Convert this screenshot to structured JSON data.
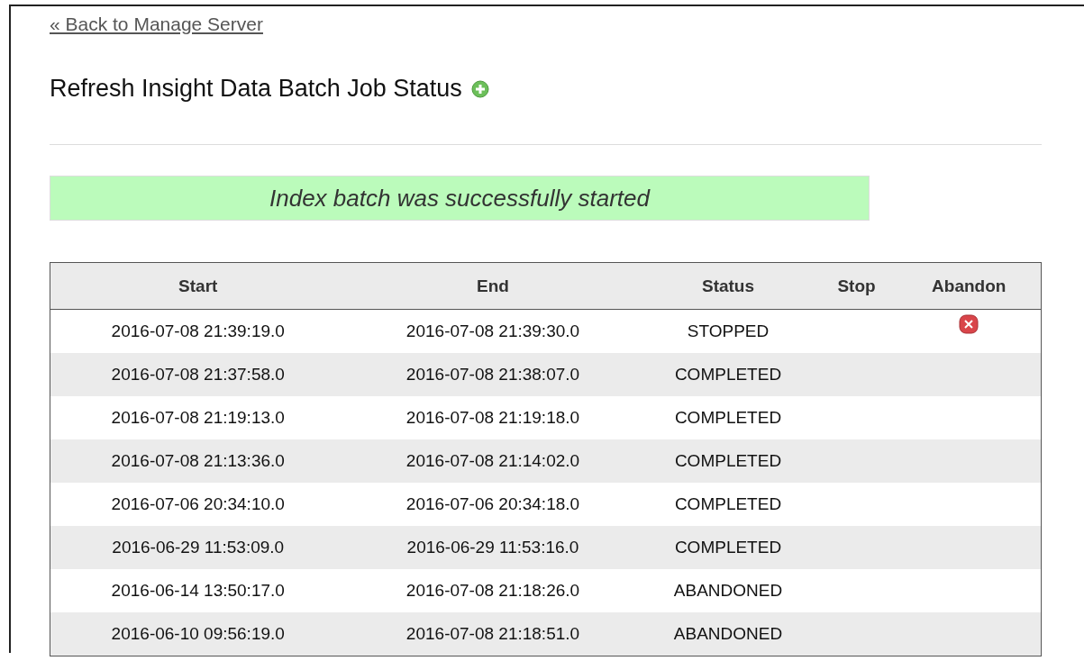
{
  "back_link": "« Back to Manage Server",
  "title": "Refresh Insight Data Batch Job Status",
  "message": "Index batch was successfully started",
  "table": {
    "columns": [
      "Start",
      "End",
      "Status",
      "Stop",
      "Abandon"
    ],
    "rows": [
      {
        "start": "2016-07-08 21:39:19.0",
        "end": "2016-07-08 21:39:30.0",
        "status": "STOPPED",
        "abandon": true
      },
      {
        "start": "2016-07-08 21:37:58.0",
        "end": "2016-07-08 21:38:07.0",
        "status": "COMPLETED",
        "abandon": false
      },
      {
        "start": "2016-07-08 21:19:13.0",
        "end": "2016-07-08 21:19:18.0",
        "status": "COMPLETED",
        "abandon": false
      },
      {
        "start": "2016-07-08 21:13:36.0",
        "end": "2016-07-08 21:14:02.0",
        "status": "COMPLETED",
        "abandon": false
      },
      {
        "start": "2016-07-06 20:34:10.0",
        "end": "2016-07-06 20:34:18.0",
        "status": "COMPLETED",
        "abandon": false
      },
      {
        "start": "2016-06-29 11:53:09.0",
        "end": "2016-06-29 11:53:16.0",
        "status": "COMPLETED",
        "abandon": false
      },
      {
        "start": "2016-06-14 13:50:17.0",
        "end": "2016-07-08 21:18:26.0",
        "status": "ABANDONED",
        "abandon": false
      },
      {
        "start": "2016-06-10 09:56:19.0",
        "end": "2016-07-08 21:18:51.0",
        "status": "ABANDONED",
        "abandon": false
      }
    ]
  }
}
